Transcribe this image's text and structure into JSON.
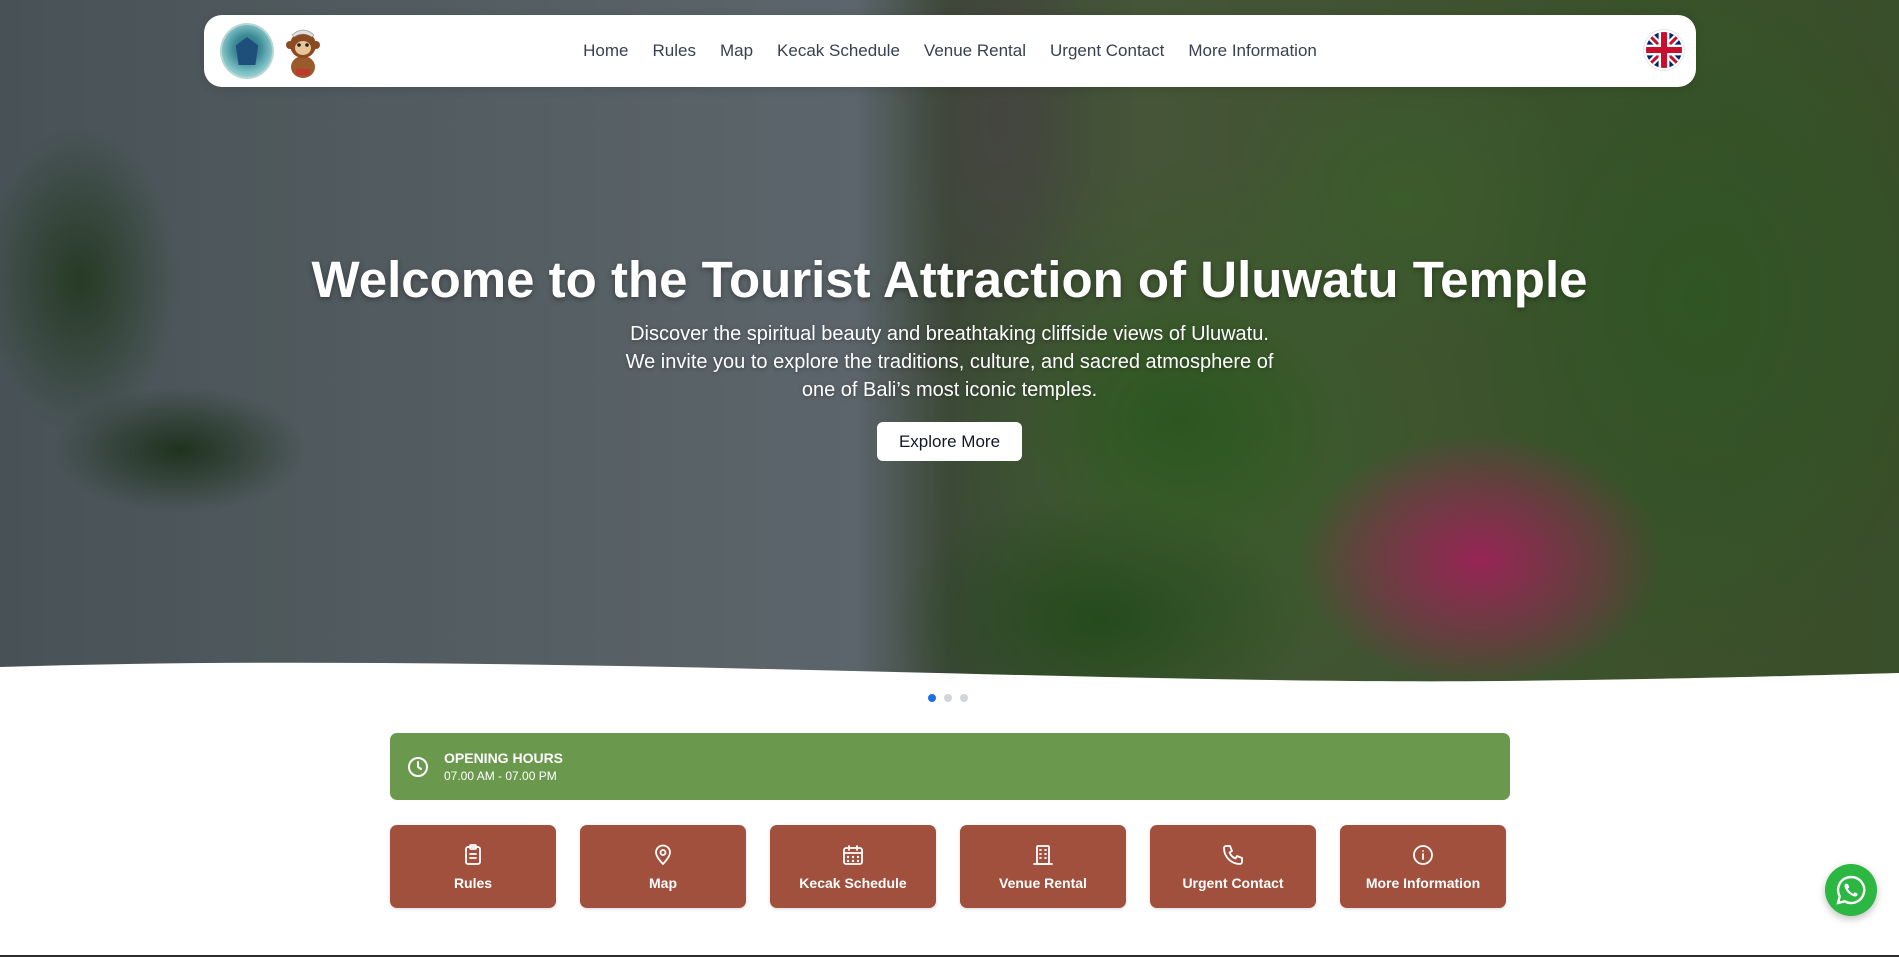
{
  "nav": {
    "logo_alt": "Uluwatu Temple logo",
    "mascot_alt": "Monkey mascot",
    "links": [
      "Home",
      "Rules",
      "Map",
      "Kecak Schedule",
      "Venue Rental",
      "Urgent Contact",
      "More Information"
    ],
    "language_icon": "uk-flag-icon"
  },
  "hero": {
    "title": "Welcome to the Tourist Attraction of Uluwatu Temple",
    "subtitle_lines": [
      "Discover the spiritual beauty and breathtaking cliffside views of Uluwatu.",
      "We invite you to explore the traditions, culture, and sacred atmosphere of",
      "one of Bali’s most iconic temples."
    ],
    "cta": "Explore More",
    "slides": 3,
    "active_slide": 1
  },
  "hours": {
    "label": "OPENING HOURS",
    "value": "07.00 AM - 07.00 PM",
    "icon": "clock-icon",
    "color": "#6a994e"
  },
  "quick_links": {
    "color": "#a0503c",
    "items": [
      {
        "label": "Rules",
        "icon": "clipboard-icon"
      },
      {
        "label": "Map",
        "icon": "map-pin-icon"
      },
      {
        "label": "Kecak Schedule",
        "icon": "calendar-icon"
      },
      {
        "label": "Venue Rental",
        "icon": "building-icon"
      },
      {
        "label": "Urgent Contact",
        "icon": "phone-icon"
      },
      {
        "label": "More Information",
        "icon": "info-icon"
      }
    ]
  },
  "whatsapp": {
    "icon": "whatsapp-icon",
    "color": "#2bb741"
  }
}
